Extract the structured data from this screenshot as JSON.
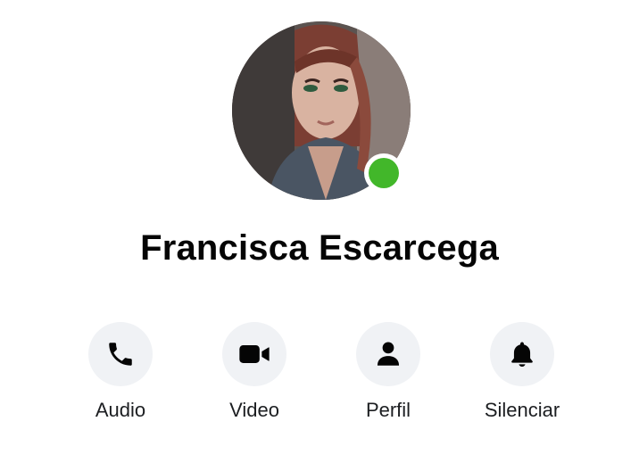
{
  "profile": {
    "name": "Francisca Escarcega",
    "status_color": "#42b72a"
  },
  "actions": [
    {
      "label": "Audio",
      "icon": "phone-icon"
    },
    {
      "label": "Video",
      "icon": "video-camera-icon"
    },
    {
      "label": "Perfil",
      "icon": "person-icon"
    },
    {
      "label": "Silenciar",
      "icon": "bell-icon"
    }
  ],
  "colors": {
    "button_bg": "#f0f2f5",
    "icon": "#050505",
    "text": "#1c1e21"
  }
}
